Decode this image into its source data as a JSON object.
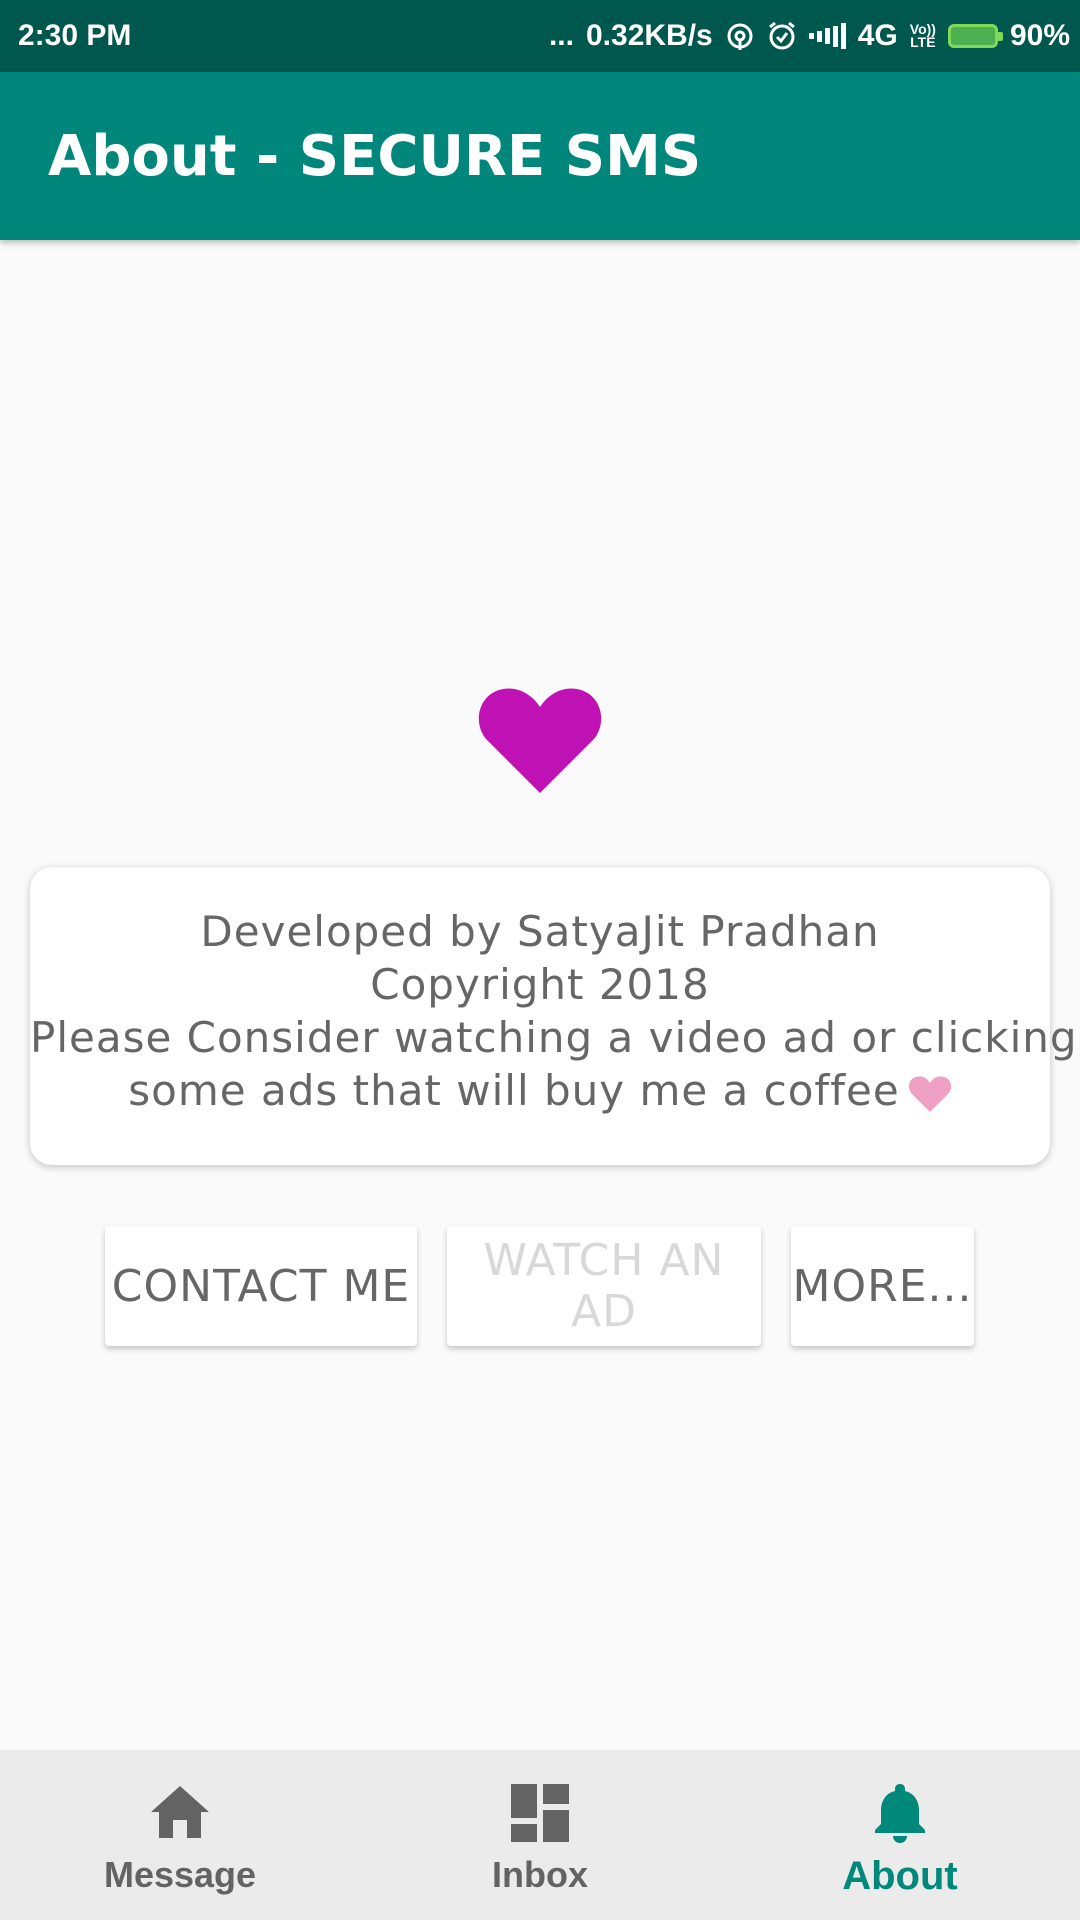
{
  "status_bar": {
    "time": "2:30 PM",
    "dots": "...",
    "speed": "0.32KB/s",
    "network": "4G",
    "volte_top": "Vo))",
    "volte_bottom": "LTE",
    "battery": "90%",
    "icons": [
      "hotspot-icon",
      "alarm-icon",
      "signal-icon",
      "volte-icon",
      "battery-charging-icon"
    ]
  },
  "app_bar": {
    "title": "About - SECURE SMS"
  },
  "hero": {
    "icon": "heart-icon",
    "color": "#c011b4"
  },
  "info_card": {
    "line1": "Developed by SatyaJit Pradhan",
    "line2": "Copyright 2018",
    "line3": "Please Consider watching a video ad or clicking",
    "line4": "some ads that will buy me a coffee",
    "heart_color": "#eea1c4"
  },
  "buttons": {
    "contact": "CONTACT ME",
    "watch": "WATCH AN AD",
    "more": "MORE..."
  },
  "bottom_nav": {
    "items": [
      {
        "label": "Message",
        "icon": "home-icon",
        "active": false
      },
      {
        "label": "Inbox",
        "icon": "dashboard-icon",
        "active": false
      },
      {
        "label": "About",
        "icon": "bell-icon",
        "active": true
      }
    ],
    "active_color": "#00897b",
    "inactive_color": "#636363"
  },
  "colors": {
    "primary": "#00867a",
    "primary_dark": "#00574e",
    "background": "#fafafa"
  }
}
